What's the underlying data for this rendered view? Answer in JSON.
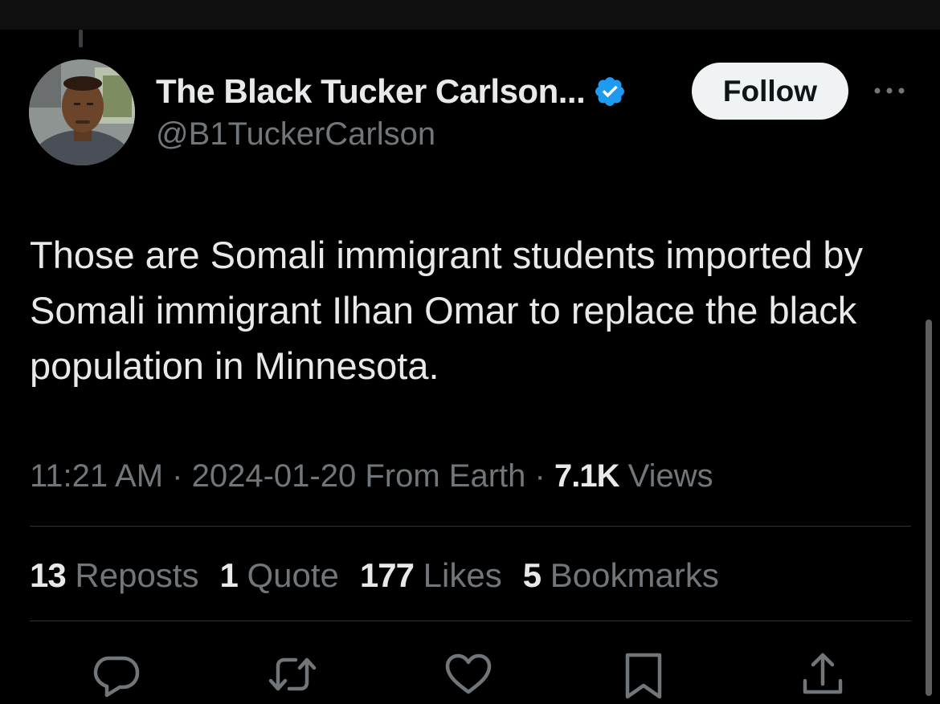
{
  "author": {
    "display_name": "The Black Tucker Carlson...",
    "handle": "@B1TuckerCarlson",
    "verified": true
  },
  "follow_label": "Follow",
  "tweet": {
    "text": "Those are Somali immigrant students imported by Somali immigrant Ilhan Omar to replace the black population in Minnesota."
  },
  "meta": {
    "time": "11:21 AM",
    "sep1": "·",
    "date": "2024-01-20",
    "source": "From Earth",
    "sep2": "·",
    "views_count": "7.1K",
    "views_label": "Views"
  },
  "stats": {
    "reposts": {
      "count": "13",
      "label": "Reposts"
    },
    "quotes": {
      "count": "1",
      "label": "Quote"
    },
    "likes": {
      "count": "177",
      "label": "Likes"
    },
    "bookmarks": {
      "count": "5",
      "label": "Bookmarks"
    }
  },
  "actions": [
    "reply-icon",
    "repost-icon",
    "like-icon",
    "bookmark-icon",
    "share-icon"
  ],
  "colors": {
    "background": "#000000",
    "text_primary": "#e7e9ea",
    "text_secondary": "#71767b",
    "verified": "#1d9bf0",
    "follow_bg": "#eff3f4",
    "divider": "#2f3336"
  }
}
